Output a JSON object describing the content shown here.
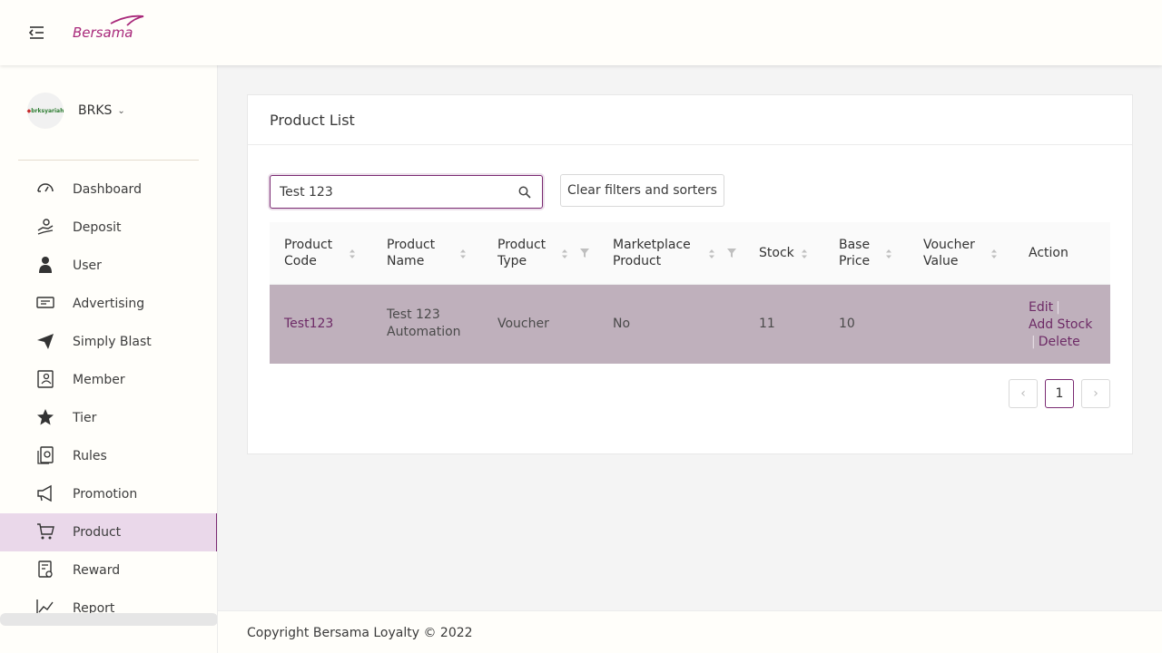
{
  "header": {
    "logo_text": "Bersama",
    "menu_icon": "menu-fold-icon",
    "brand_color": "#a8287a"
  },
  "sidebar": {
    "account": {
      "name": "BRKS",
      "avatar_text": "brksyariah"
    },
    "items": [
      {
        "label": "Dashboard",
        "icon": "dashboard-icon"
      },
      {
        "label": "Deposit",
        "icon": "deposit-icon"
      },
      {
        "label": "User",
        "icon": "user-icon"
      },
      {
        "label": "Advertising",
        "icon": "advertising-icon"
      },
      {
        "label": "Simply Blast",
        "icon": "send-icon"
      },
      {
        "label": "Member",
        "icon": "member-card-icon"
      },
      {
        "label": "Tier",
        "icon": "star-icon"
      },
      {
        "label": "Rules",
        "icon": "rules-icon"
      },
      {
        "label": "Promotion",
        "icon": "megaphone-icon"
      },
      {
        "label": "Product",
        "icon": "cart-icon",
        "active": true
      },
      {
        "label": "Reward",
        "icon": "reward-icon"
      },
      {
        "label": "Report",
        "icon": "chart-line-icon"
      }
    ],
    "active_color": "#ead8ea"
  },
  "main": {
    "title": "Product List",
    "search": {
      "value": "Test 123"
    },
    "clear_button": "Clear filters and sorters",
    "table": {
      "columns": [
        {
          "line1": "Product",
          "line2": "Code"
        },
        {
          "line1": "Product",
          "line2": "Name"
        },
        {
          "line1": "Product",
          "line2": "Type"
        },
        {
          "line1": "Marketplace",
          "line2": "Product"
        },
        {
          "line1": "Stock",
          "line2": ""
        },
        {
          "line1": "Base",
          "line2": "Price"
        },
        {
          "line1": "Voucher",
          "line2": "Value"
        },
        {
          "line1": "Action",
          "line2": ""
        }
      ],
      "rows": [
        {
          "code": "Test123",
          "name_line1": "Test 123",
          "name_line2": "Automation",
          "type": "Voucher",
          "marketplace": "No",
          "stock": "11",
          "base_price": "10",
          "voucher_value": "",
          "actions": {
            "edit": "Edit",
            "add_stock": "Add Stock",
            "delete": "Delete",
            "separator": "|"
          }
        }
      ],
      "row_color": "#bfb0bc"
    },
    "pagination": {
      "prev": "‹",
      "current": "1",
      "next": "›"
    }
  },
  "footer": {
    "text": "Copyright Bersama Loyalty © 2022"
  }
}
